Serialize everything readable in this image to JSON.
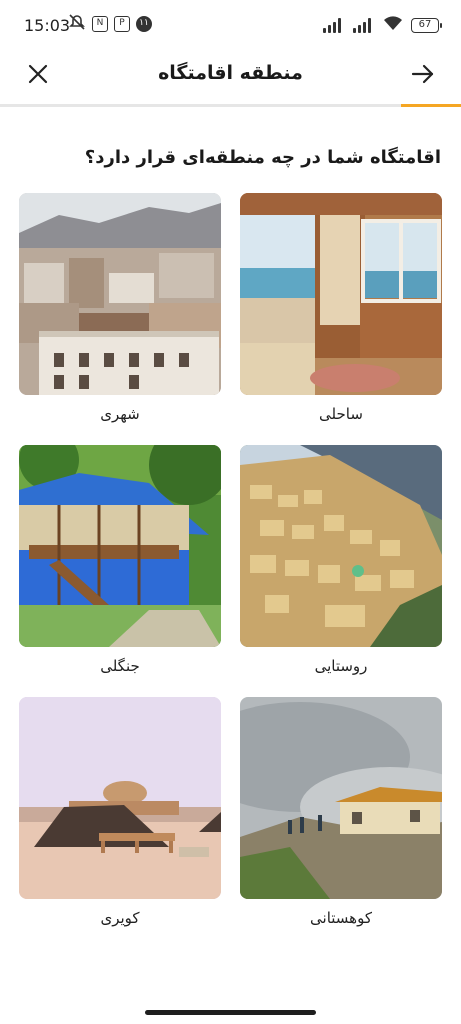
{
  "status_bar": {
    "time": "15:03",
    "battery": "67",
    "notification_badge": "۱۱"
  },
  "header": {
    "title": "منطقه اقامتگاه",
    "progress_fraction": 0.13
  },
  "question": "اقامتگاه شما در چه منطقه‌ای قرار دارد؟",
  "options": [
    {
      "label": "ساحلی",
      "image": "beach-room-image"
    },
    {
      "label": "شهری",
      "image": "city-image"
    },
    {
      "label": "روستایی",
      "image": "village-image"
    },
    {
      "label": "جنگلی",
      "image": "forest-house-image"
    },
    {
      "label": "کوهستانی",
      "image": "mountain-image"
    },
    {
      "label": "کویری",
      "image": "desert-image"
    }
  ],
  "colors": {
    "accent": "#f5a623",
    "divider": "#e6e6e6",
    "text": "#1a1a1a"
  }
}
